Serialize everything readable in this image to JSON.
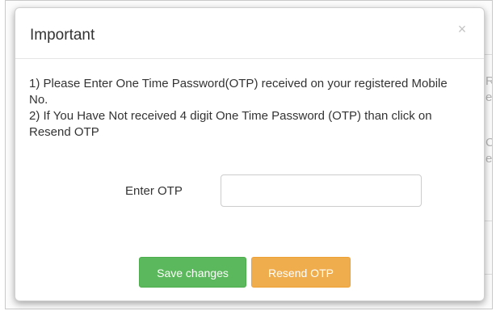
{
  "modal": {
    "title": "Important",
    "close_glyph": "×",
    "instructions": [
      "1) Please Enter One Time Password(OTP) received on your registered Mobile No.",
      "2) If You Have Not received 4 digit One Time Password (OTP) than click on Resend OTP"
    ],
    "otp": {
      "label": "Enter OTP",
      "value": "",
      "placeholder": ""
    },
    "buttons": {
      "save_label": "Save changes",
      "resend_label": "Resend OTP"
    }
  },
  "colors": {
    "save_button": "#5cb85c",
    "resend_button": "#f0ad4e"
  }
}
